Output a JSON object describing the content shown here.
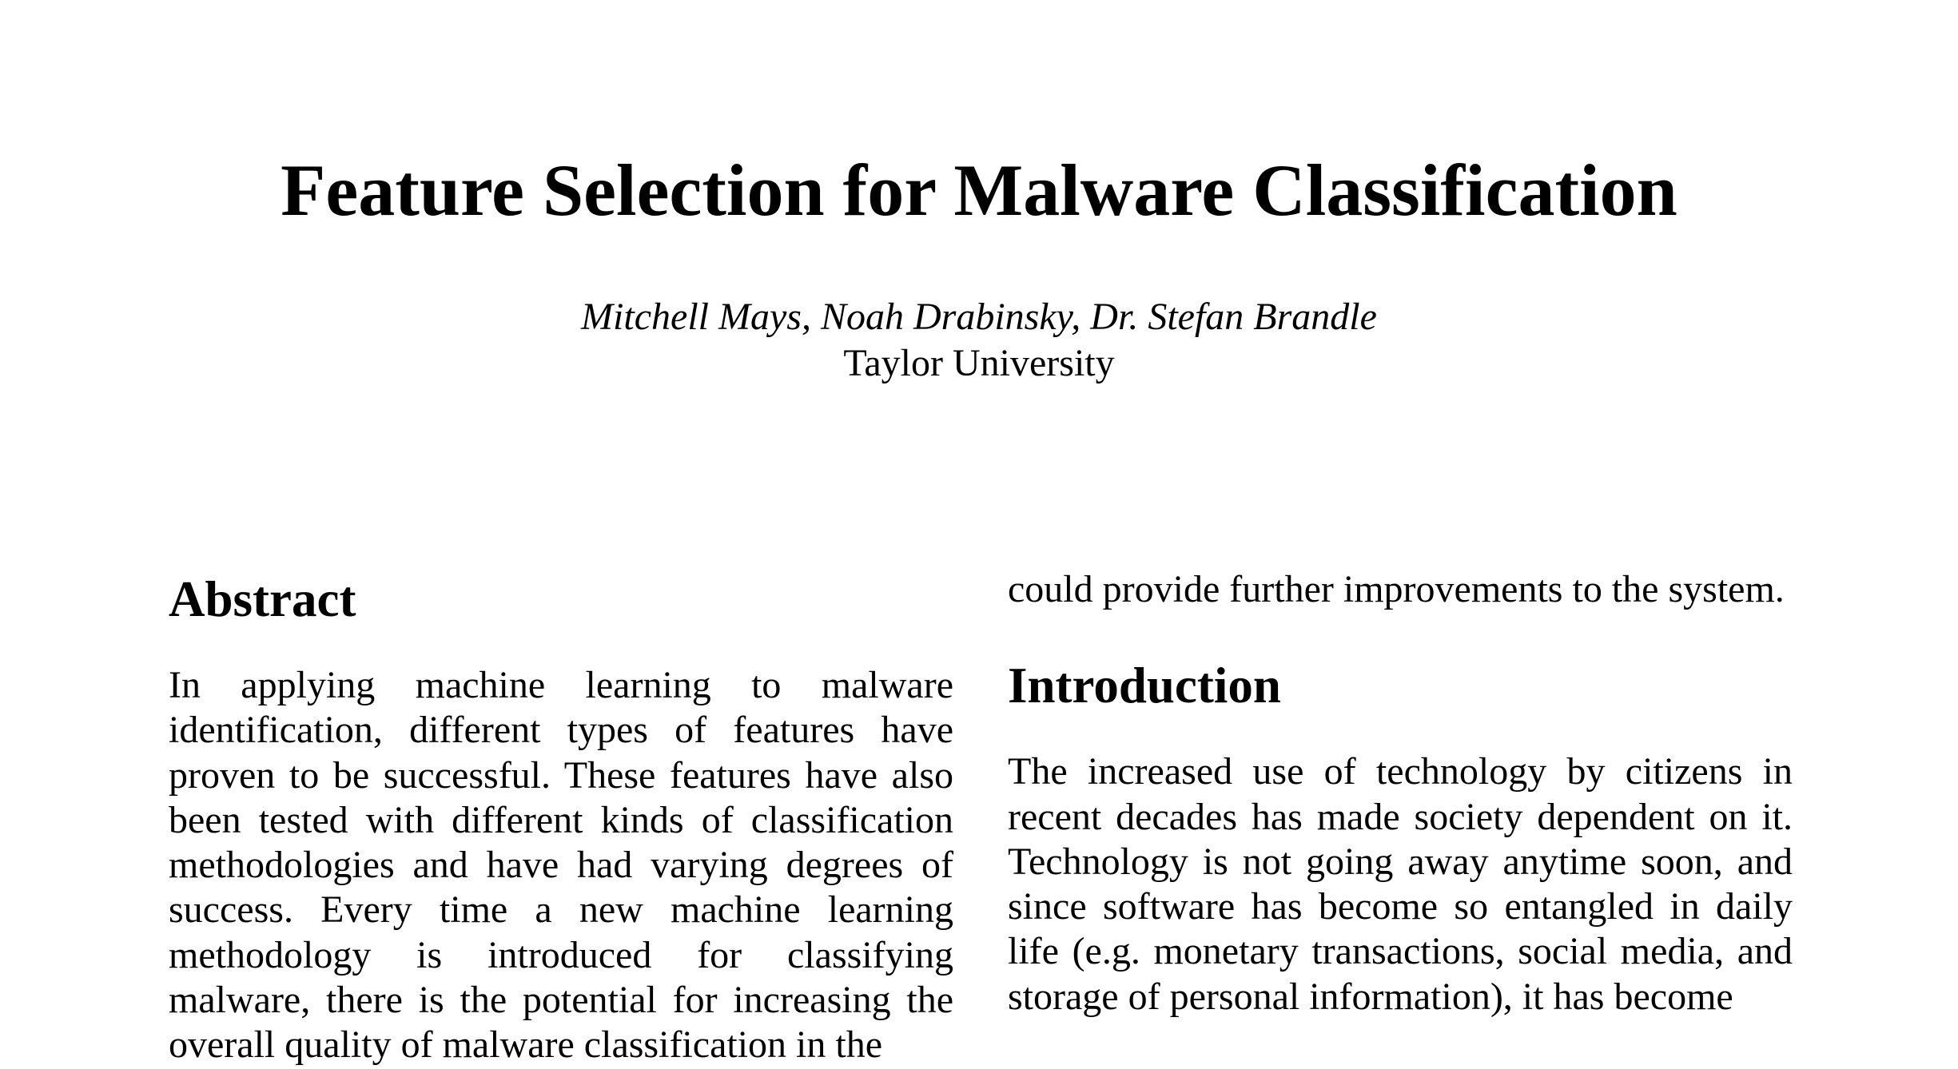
{
  "paper": {
    "title": "Feature Selection for Malware Classification",
    "authors": "Mitchell Mays, Noah Drabinsky, Dr. Stefan Brandle",
    "affiliation": "Taylor University"
  },
  "abstract": {
    "heading": "Abstract",
    "text": "In applying machine learning to malware identification, different types of features have proven to be successful. These features have also been tested with different kinds of classification methodologies and have had varying degrees of success. Every time a new machine learning methodology is introduced for classifying malware, there is the potential for increasing the overall quality of malware classification in the"
  },
  "right_column": {
    "continuation_text": "could provide further improvements to the system."
  },
  "introduction": {
    "heading": "Introduction",
    "text": "The increased use of technology by citizens in recent decades has made society dependent on it. Technology is not going away anytime soon, and since software has become so entangled in daily life (e.g. monetary transactions, social media, and storage of personal information), it has become"
  }
}
